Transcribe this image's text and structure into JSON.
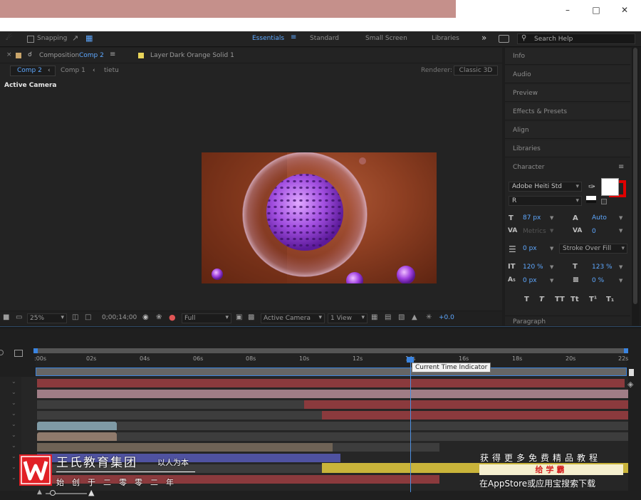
{
  "toolbar": {
    "snapping_label": "Snapping",
    "workspaces": [
      "Essentials",
      "Standard",
      "Small Screen",
      "Libraries"
    ],
    "active_workspace": "Essentials",
    "more_glyph": "»",
    "search_placeholder": "Search Help"
  },
  "comp_panel": {
    "close_glyph": "×",
    "tab_prefix": "Composition",
    "tab_name": "Comp 2",
    "menu_glyph": "≡",
    "layer_prefix": "Layer",
    "layer_name": "Dark Orange Solid 1",
    "breadcrumbs": [
      "Comp 2",
      "Comp 1",
      "tietu"
    ],
    "renderer_label": "Renderer:",
    "renderer_value": "Classic 3D",
    "view_label": "Active Camera"
  },
  "viewer_controls": {
    "zoom": "25%",
    "timecode": "0;00;14;00",
    "resolution": "Full",
    "camera": "Active Camera",
    "views": "1 View",
    "exposure": "+0.0"
  },
  "right_panels": {
    "items": [
      "Info",
      "Audio",
      "Preview",
      "Effects & Presets",
      "Align",
      "Libraries",
      "Character"
    ],
    "character_menu_glyph": "≡",
    "font_family": "Adobe Heiti Std",
    "font_style": "R",
    "font_size": "87 px",
    "leading": "Auto",
    "kerning": "Metrics",
    "tracking": "0",
    "stroke_width": "0 px",
    "stroke_type": "Stroke Over Fill",
    "vert_scale": "120 %",
    "horiz_scale": "123 %",
    "baseline_shift": "0 px",
    "tsume": "0 %",
    "style_buttons": [
      "T",
      "T",
      "TT",
      "Tt",
      "T¹",
      "T₁"
    ],
    "paragraph_label": "Paragraph",
    "fill_color": "#ffffff",
    "stroke_color": "#e00000"
  },
  "timeline": {
    "ruler_labels": [
      ":00s",
      "02s",
      "04s",
      "06s",
      "08s",
      "10s",
      "12s",
      "14s",
      "16s",
      "18s",
      "20s",
      "22s"
    ],
    "tooltip": "Current Time Indicator"
  },
  "watermark": {
    "logo_letter": "W",
    "title": "王氏教育集团",
    "motto": "以人为本",
    "subtitle": "始创于二零零二年",
    "promo_top": "获得更多免费精品教程",
    "promo_badge": "给学霸",
    "promo_bottom": "在AppStore或应用宝搜索下载"
  },
  "colors": {
    "accent_blue": "#5ea8ff",
    "bar_red": "#8b3a3d",
    "bar_pink": "#a07d86",
    "bar_blue": "#4f52a0",
    "bar_yellow": "#c9b43a",
    "bar_teal": "#7f9aa5",
    "bar_tan": "#8f7a6c",
    "watermark_red": "#e12026"
  }
}
